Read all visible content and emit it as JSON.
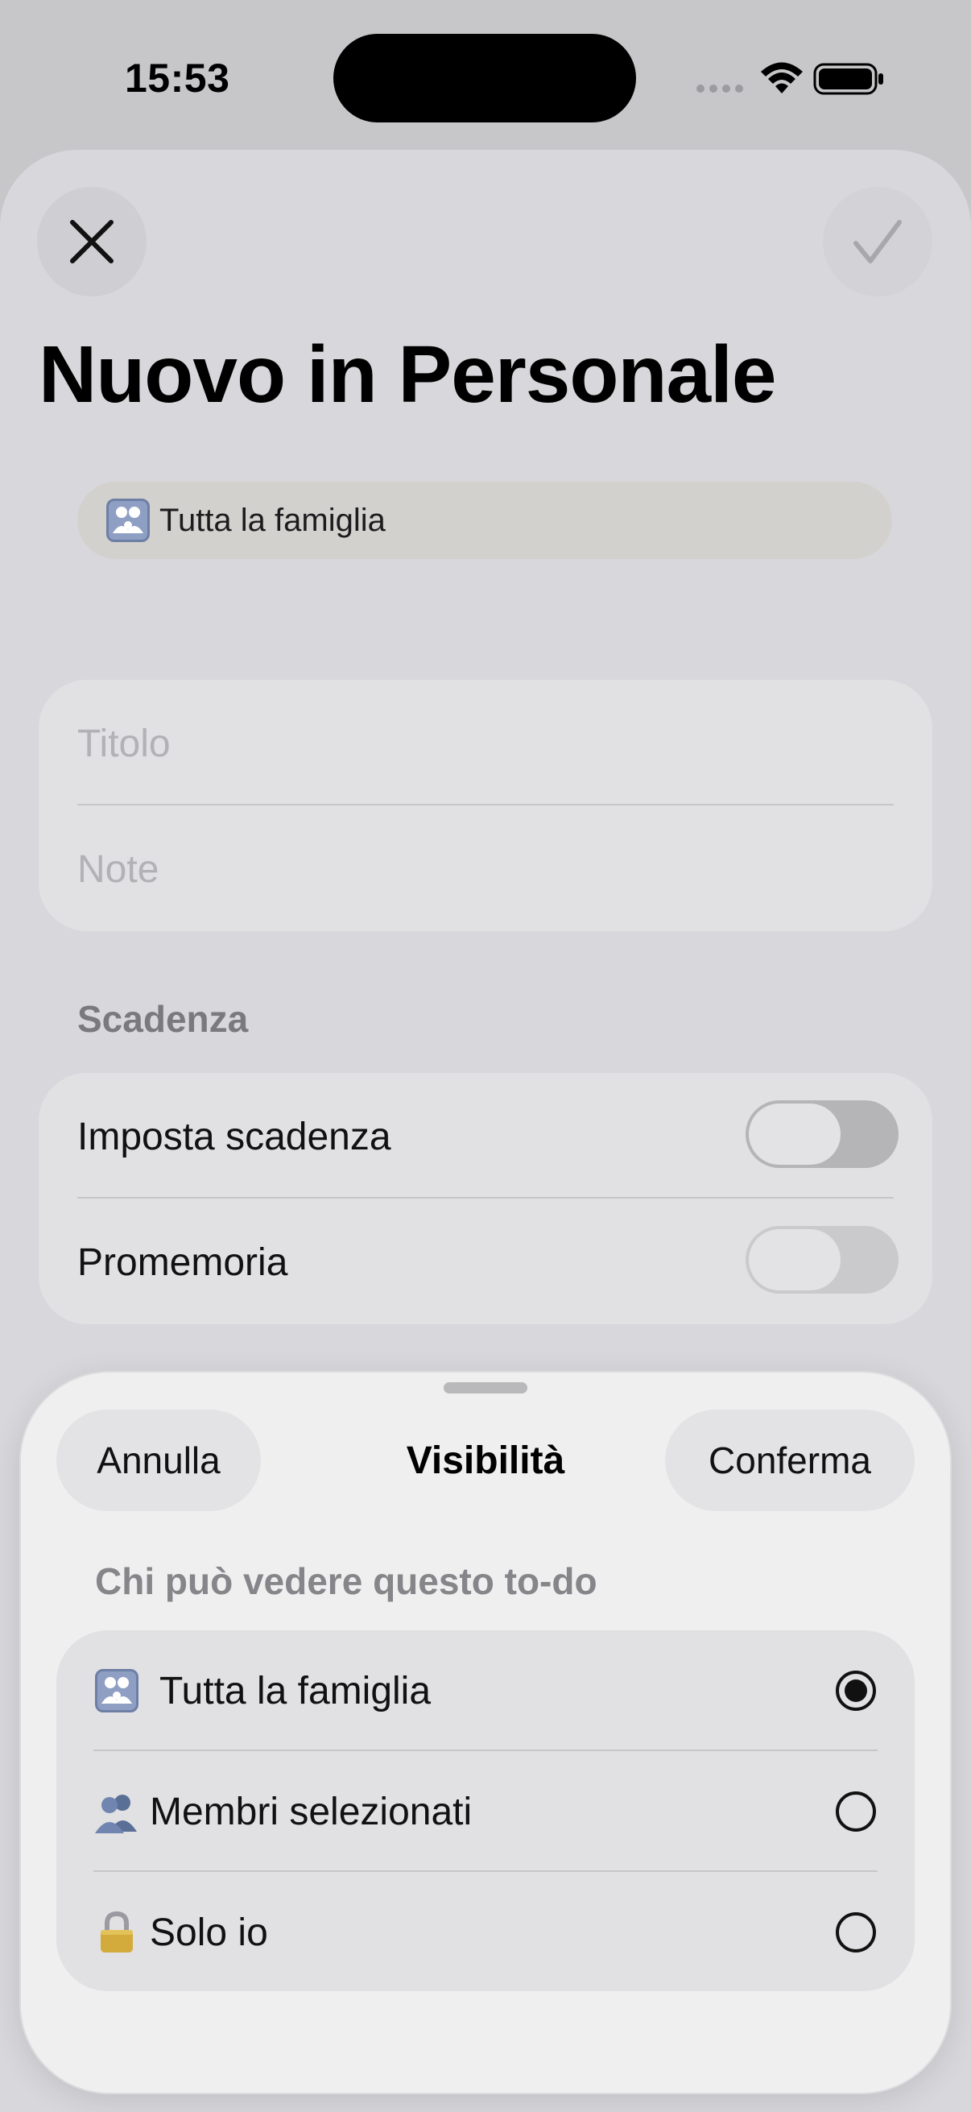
{
  "status_bar": {
    "time": "15:53"
  },
  "header": {
    "close_icon": "close-icon",
    "confirm_icon": "checkmark-icon",
    "title": "Nuovo in Personale"
  },
  "visibility_chip": {
    "icon": "family-icon",
    "label": "Tutta la famiglia"
  },
  "form": {
    "title_placeholder": "Titolo",
    "notes_placeholder": "Note"
  },
  "due_section": {
    "header": "Scadenza",
    "rows": [
      {
        "label": "Imposta scadenza",
        "on": false
      },
      {
        "label": "Promemoria",
        "on": false
      }
    ]
  },
  "visibility_sheet": {
    "cancel_label": "Annulla",
    "title": "Visibilità",
    "confirm_label": "Conferma",
    "subtitle": "Chi può vedere questo to-do",
    "options": [
      {
        "icon": "family-icon",
        "label": "Tutta la famiglia",
        "selected": true
      },
      {
        "icon": "people-icon",
        "label": "Membri selezionati",
        "selected": false
      },
      {
        "icon": "lock-icon",
        "label": "Solo io",
        "selected": false
      }
    ]
  }
}
